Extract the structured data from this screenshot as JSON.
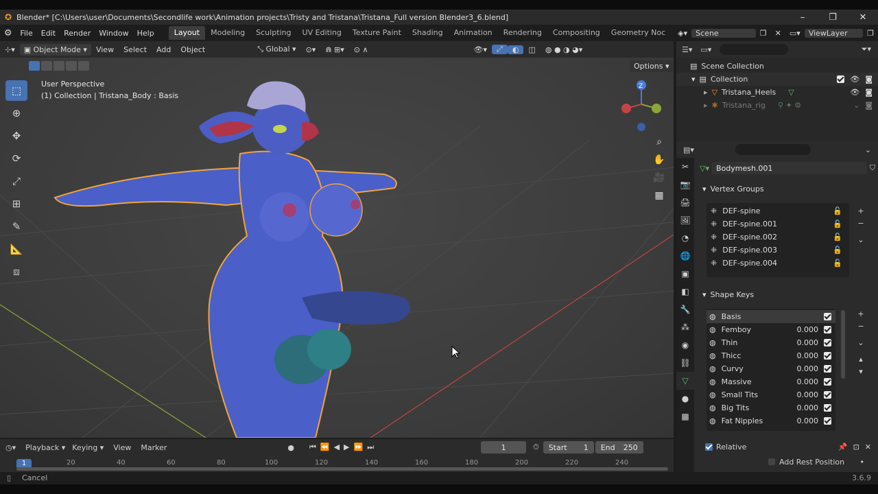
{
  "window": {
    "title": "Blender* [C:\\Users\\user\\Documents\\Secondlife work\\Animation projects\\Tristy and Tristana\\Tristana_Full version Blender3_6.blend]",
    "minimize": "–",
    "maximize": "❐",
    "close": "✕"
  },
  "menu": {
    "items": [
      "File",
      "Edit",
      "Render",
      "Window",
      "Help"
    ]
  },
  "workspaces": [
    "Layout",
    "Modeling",
    "Sculpting",
    "UV Editing",
    "Texture Paint",
    "Shading",
    "Animation",
    "Rendering",
    "Compositing",
    "Geometry Noc"
  ],
  "scene": {
    "label": "Scene",
    "view_layer": "ViewLayer"
  },
  "viewport_header": {
    "mode": "Object Mode",
    "menus": [
      "View",
      "Select",
      "Add",
      "Object"
    ],
    "transform_orientation": "Global",
    "options_label": "Options"
  },
  "viewport": {
    "perspective": "User Perspective",
    "collection_info": "(1) Collection | Tristana_Body : Basis",
    "gizmo_axis_label": "Z"
  },
  "outliner": {
    "scene_collection": "Scene Collection",
    "collection": "Collection",
    "objects": [
      "Tristana_Heels",
      "Tristana_rig"
    ]
  },
  "properties": {
    "mesh_name": "Bodymesh.001",
    "vertex_groups_title": "Vertex Groups",
    "vertex_groups": [
      "DEF-spine",
      "DEF-spine.001",
      "DEF-spine.002",
      "DEF-spine.003",
      "DEF-spine.004"
    ],
    "shape_keys_title": "Shape Keys",
    "shape_keys": [
      {
        "name": "Basis",
        "value": ""
      },
      {
        "name": "Femboy",
        "value": "0.000"
      },
      {
        "name": "Thin",
        "value": "0.000"
      },
      {
        "name": "Thicc",
        "value": "0.000"
      },
      {
        "name": "Curvy",
        "value": "0.000"
      },
      {
        "name": "Massive",
        "value": "0.000"
      },
      {
        "name": "Small Tits",
        "value": "0.000"
      },
      {
        "name": "Big Tits",
        "value": "0.000"
      },
      {
        "name": "Fat Nipples",
        "value": "0.000"
      }
    ],
    "relative_label": "Relative",
    "add_rest_position": "Add Rest Position"
  },
  "timeline": {
    "menus": [
      "Playback",
      "Keying",
      "View",
      "Marker"
    ],
    "current_frame": "1",
    "start_label": "Start",
    "start_value": "1",
    "end_label": "End",
    "end_value": "250",
    "ruler_current": "1",
    "ruler_ticks": [
      "20",
      "40",
      "60",
      "80",
      "100",
      "120",
      "140",
      "160",
      "180",
      "200",
      "220",
      "240"
    ]
  },
  "status": {
    "cancel": "Cancel",
    "version": "3.6.9"
  },
  "colors": {
    "accent_blue": "#4772b3",
    "selection_outline": "#f2a43c",
    "body_blue": "#4a5fc8",
    "x_axis": "#c44444",
    "y_axis": "#8aa63a"
  }
}
